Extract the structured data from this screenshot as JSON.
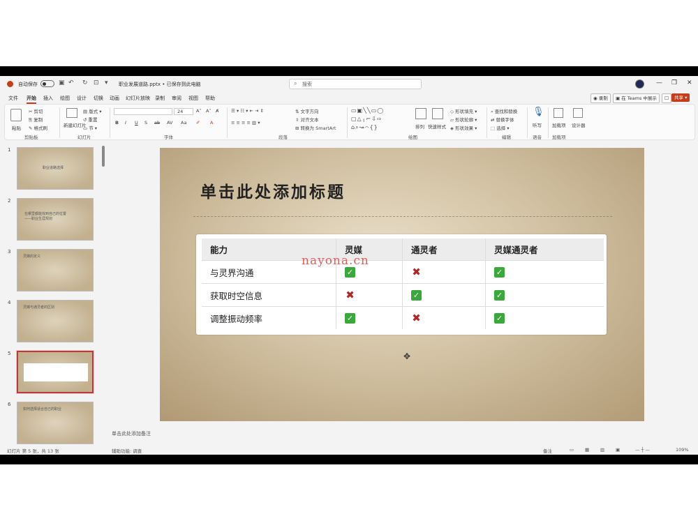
{
  "titlebar": {
    "autosave_label": "自动保存",
    "filename": "职业发展道路.pptx • 已保存到此电脑",
    "search_placeholder": "搜索"
  },
  "menu": {
    "tabs": [
      "文件",
      "开始",
      "插入",
      "绘图",
      "设计",
      "切换",
      "动画",
      "幻灯片放映",
      "录制",
      "审阅",
      "视图",
      "帮助"
    ],
    "active_tab": "开始",
    "record_label": "录制",
    "teams_label": "在 Teams 中展示",
    "share_label": "共享"
  },
  "ribbon": {
    "groups": [
      "剪贴板",
      "幻灯片",
      "字体",
      "段落",
      "绘图",
      "编辑",
      "语音",
      "加载项"
    ],
    "clipboard": {
      "paste": "粘贴",
      "cut": "剪切",
      "copy": "复制",
      "format_painter": "格式刷"
    },
    "slides": {
      "new_slide": "新建幻灯片",
      "layout": "版式",
      "reset": "重置",
      "section": "节"
    },
    "font": {
      "size": "24"
    },
    "paragraph": {
      "text_direction": "文字方向",
      "align_text": "对齐文本",
      "smartart": "转换为 SmartArt"
    },
    "drawing": {
      "arrange": "排列",
      "quick_styles": "快速样式",
      "shape_fill": "形状填充",
      "shape_outline": "形状轮廓",
      "shape_effects": "形状效果"
    },
    "editing": {
      "find": "查找和替换",
      "replace": "替换字体",
      "select": "选择"
    },
    "voice": {
      "dictate": "听写"
    },
    "addins": {
      "addins": "加载项",
      "designer": "设计器"
    }
  },
  "thumbnails": [
    {
      "number": "1",
      "text": "职业道路选择"
    },
    {
      "number": "2",
      "text": "在哪里都能找到自己的位置\n——职业生涯规划"
    },
    {
      "number": "3",
      "text": "灵媒的定义"
    },
    {
      "number": "4",
      "text": "灵媒与通灵者的区别"
    },
    {
      "number": "5",
      "text": ""
    },
    {
      "number": "6",
      "text": "如何选择适合自己的职业"
    }
  ],
  "slide": {
    "title": "单击此处添加标题",
    "table": {
      "headers": [
        "能力",
        "灵媒",
        "通灵者",
        "灵媒通灵者"
      ],
      "rows": [
        {
          "label": "与灵界沟通",
          "cells": [
            "check",
            "cross",
            "check"
          ]
        },
        {
          "label": "获取时空信息",
          "cells": [
            "cross",
            "check",
            "check"
          ]
        },
        {
          "label": "调整振动频率",
          "cells": [
            "check",
            "cross",
            "check"
          ]
        }
      ]
    },
    "watermark": "nayona.cn"
  },
  "notes_placeholder": "单击此处添加备注",
  "status": {
    "slide_info": "幻灯片 第 5 张，共 13 张",
    "accessibility": "辅助功能: 调查",
    "notes": "备注",
    "zoom": "109%"
  },
  "colors": {
    "accent": "#c43e1c",
    "check": "#3aa83a",
    "cross": "#b02828"
  }
}
